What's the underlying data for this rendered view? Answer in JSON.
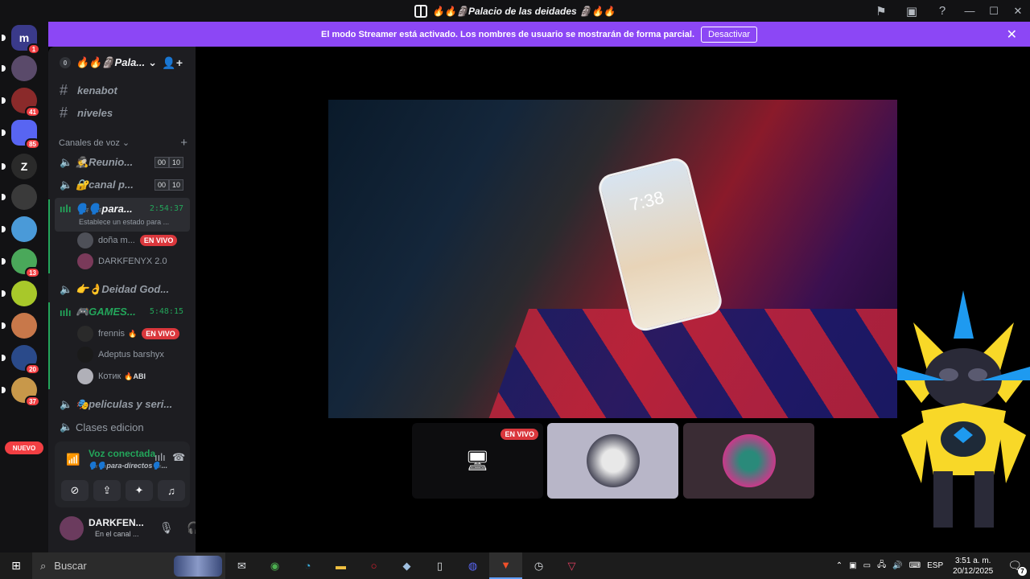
{
  "window": {
    "title": "🔥🔥🗿Palacio de las deidades 🗿🔥🔥",
    "icons": [
      "inbox-flag-icon",
      "screen-share-icon",
      "help-icon",
      "minimize-icon",
      "maximize-icon",
      "close-icon"
    ]
  },
  "streamer_banner": {
    "message": "El modo Streamer está activado. Los nombres de usuario se mostrarán de forma parcial.",
    "button": "Desactivar",
    "close": "✕"
  },
  "servers": [
    {
      "label": "m",
      "badge": "1",
      "color": "#3a3a8a"
    },
    {
      "label": "",
      "badge": "",
      "color": "#5a4a6a"
    },
    {
      "label": "",
      "badge": "41",
      "color": "#8a2a2a"
    },
    {
      "label": "",
      "badge": "85",
      "color": "#5865f2"
    },
    {
      "label": "Z",
      "badge": "",
      "color": "#2a2a2a"
    },
    {
      "label": "",
      "badge": "",
      "color": "#3a3a3a"
    },
    {
      "label": "",
      "badge": "",
      "color": "#4a9ad8"
    },
    {
      "label": "",
      "badge": "13",
      "color": "#4aa85a"
    },
    {
      "label": "",
      "badge": "",
      "color": "#a8c82a"
    },
    {
      "label": "",
      "badge": "",
      "color": "#c8784a"
    },
    {
      "label": "",
      "badge": "20",
      "color": "#2a4a8a"
    },
    {
      "label": "",
      "badge": "37",
      "color": "#c8984a"
    }
  ],
  "servers_new_label": "NUEVO",
  "guild": {
    "zero_badge": "0",
    "name": "🔥🔥🗿Pala...",
    "chevron": "⌄"
  },
  "text_channels": [
    "kenabot",
    "niveles"
  ],
  "voice_category": "Canales de voz",
  "voice_channels": [
    {
      "name": "🕵️Reunio...",
      "count_a": "00",
      "count_b": "10"
    },
    {
      "name": "🔐canal p...",
      "count_a": "00",
      "count_b": "10"
    }
  ],
  "active_voice": {
    "name": "🗣️🗣️para...",
    "timer": "2:54:37",
    "status": "Establece un estado para ..."
  },
  "active_voice_users": [
    {
      "name": "doña m...",
      "live": "EN VIVO"
    },
    {
      "name": "DARKFENYX 2.0",
      "live": ""
    }
  ],
  "voice_deidad": "👉👌Deidad God...",
  "games_channel": {
    "name": "🎮GAMES...",
    "timer": "5:48:15"
  },
  "games_users": [
    {
      "name": "frennis",
      "live": "EN VIVO",
      "extra": "🔥"
    },
    {
      "name": "Adeptus barshyx",
      "live": "",
      "extra": ""
    },
    {
      "name": "Котик",
      "live": "",
      "extra": "🔥ABI"
    }
  ],
  "more_channels": [
    "🎭peliculas y seri...",
    "Clases edicion"
  ],
  "voice_panel": {
    "status": "Voz conectada",
    "channel": "🗣️🗣️para-directos🗣️..."
  },
  "user": {
    "name": "DARKFEN...",
    "status": "En el canal ..."
  },
  "stream": {
    "phone_time": "7:38",
    "thumbnails": [
      {
        "kind": "screen",
        "live": "EN VIVO"
      },
      {
        "kind": "avatar",
        "live": ""
      },
      {
        "kind": "avatar",
        "live": ""
      }
    ]
  },
  "taskbar": {
    "search_placeholder": "Buscar",
    "lang": "ESP",
    "time": "3:51 a. m.",
    "date": "20/12/2025",
    "notifications": "7"
  }
}
